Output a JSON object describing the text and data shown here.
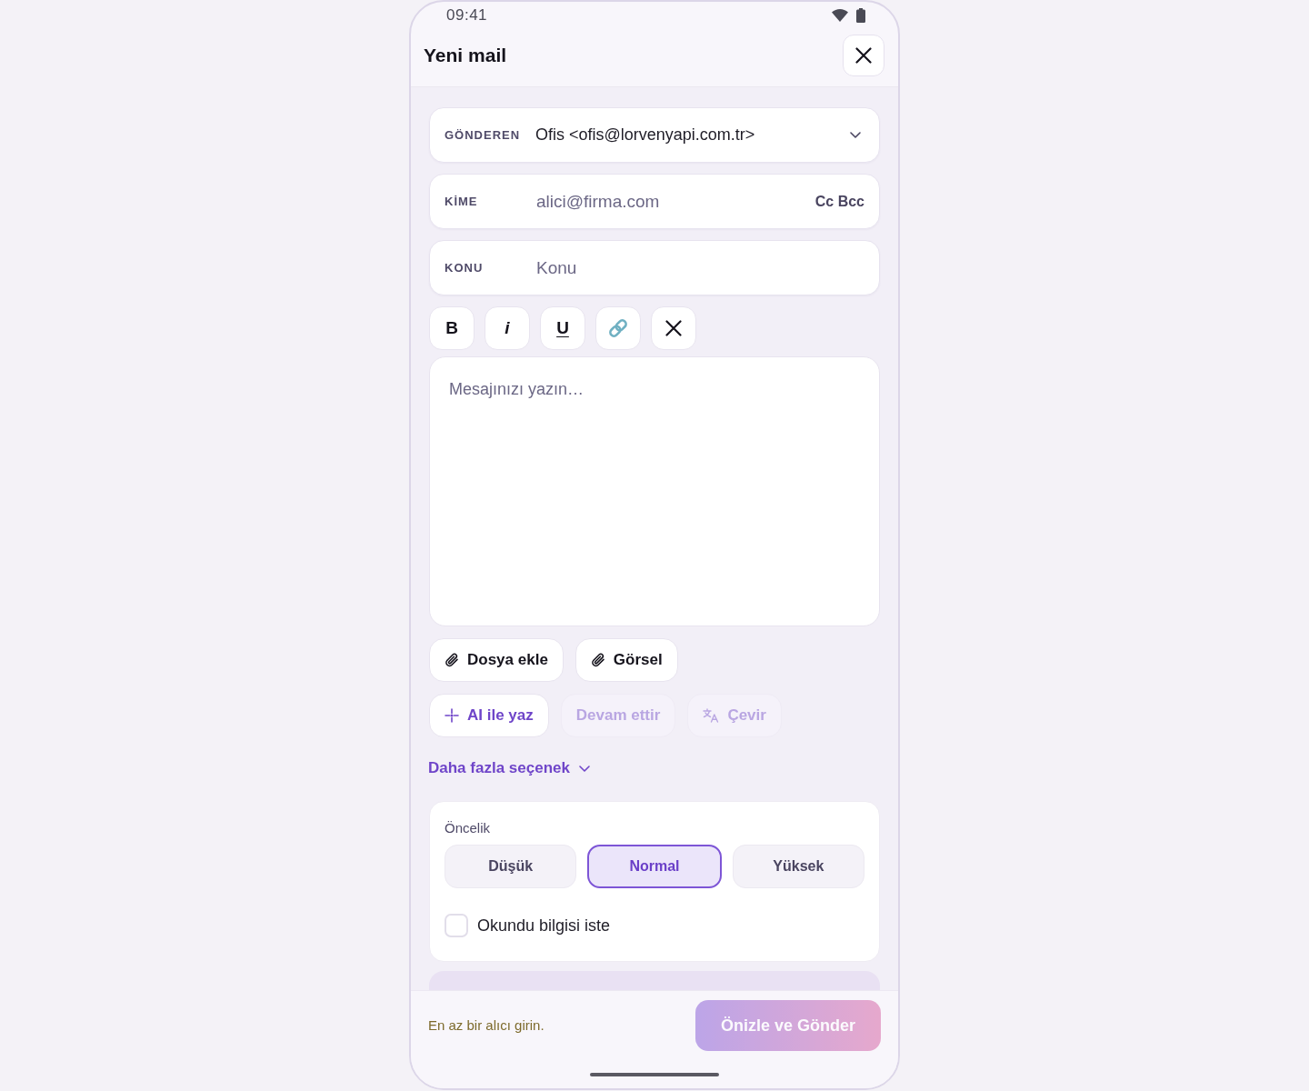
{
  "status_bar": {
    "time": "09:41"
  },
  "header": {
    "title": "Yeni mail"
  },
  "fields": [
    {
      "kind": "select",
      "label": "GÖNDEREN",
      "value": "Ofis <ofis@lorvenyapi.com.tr>"
    },
    {
      "kind": "input",
      "label": "KİME",
      "placeholder": "alici@firma.com",
      "action": "Cc Bcc"
    },
    {
      "kind": "input",
      "label": "KONU",
      "placeholder": "Konu"
    }
  ],
  "format_toolbar": [
    {
      "kind": "bold",
      "label": "B"
    },
    {
      "kind": "italic",
      "label": "i"
    },
    {
      "kind": "underline",
      "label": "U"
    },
    {
      "kind": "link"
    },
    {
      "kind": "clear"
    }
  ],
  "message": {
    "placeholder": "Mesajınızı yazın…"
  },
  "attachments": [
    {
      "label": "Dosya ekle"
    },
    {
      "label": "Görsel"
    }
  ],
  "ai_actions": [
    {
      "kind": "sparkle",
      "label": "AI ile yaz",
      "disabled": false
    },
    {
      "kind": "plain",
      "label": "Devam ettir",
      "disabled": true
    },
    {
      "kind": "translate",
      "label": "Çevir",
      "disabled": true
    }
  ],
  "more_options": {
    "label": "Daha fazla seçenek"
  },
  "priority": {
    "label": "Öncelik",
    "options": [
      {
        "label": "Düşük",
        "selected": false
      },
      {
        "label": "Normal",
        "selected": true
      },
      {
        "label": "Yüksek",
        "selected": false
      }
    ]
  },
  "read_receipt": {
    "label": "Okundu bilgisi iste",
    "checked": false
  },
  "footer": {
    "hint": "En az bir alıcı girin.",
    "send_button": {
      "label": "Önizle ve Gönder",
      "disabled": true
    }
  }
}
